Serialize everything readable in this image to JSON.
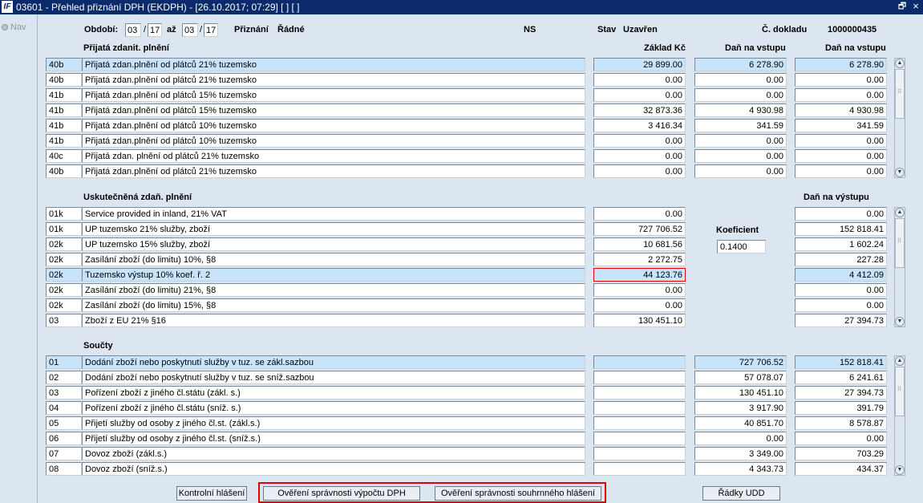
{
  "window": {
    "logo_text": "IF",
    "title": "03601 - Přehled přiznání DPH (EKDPH) - [26.10.2017; 07:29]  [ ]  [ ]",
    "restore_glyph": "🗗",
    "close_glyph": "×"
  },
  "nav": {
    "label": "Nav"
  },
  "header": {
    "obdobi_label": "Období:",
    "from_month": "03",
    "from_year": "17",
    "az_label": "až",
    "to_month": "03",
    "to_year": "17",
    "slash": "/",
    "priznani_label": "Přiznání",
    "priznani_value": "Řádné",
    "ns_label": "NS",
    "stav_label": "Stav",
    "stav_value": "Uzavřen",
    "doklad_label": "Č. dokladu",
    "doklad_value": "1000000435"
  },
  "section_prijata": {
    "title": "Přijatá zdanit. plnění",
    "col_zaklad": "Základ Kč",
    "col_dan_vstup1": "Daň na vstupu",
    "col_dan_vstup2": "Daň na vstupu",
    "rows": [
      {
        "code": "40b",
        "desc": "Přijatá zdan.plnění od plátců 21% tuzemsko",
        "zaklad": "29 899.00",
        "dan1": "6 278.90",
        "dan2": "6 278.90"
      },
      {
        "code": "40b",
        "desc": "Přijatá zdan.plnění od plátců 21% tuzemsko",
        "zaklad": "0.00",
        "dan1": "0.00",
        "dan2": "0.00"
      },
      {
        "code": "41b",
        "desc": "Přijatá zdan.plnění od plátců 15% tuzemsko",
        "zaklad": "0.00",
        "dan1": "0.00",
        "dan2": "0.00"
      },
      {
        "code": "41b",
        "desc": "Přijatá zdan.plnění od plátců 15% tuzemsko",
        "zaklad": "32 873.36",
        "dan1": "4 930.98",
        "dan2": "4 930.98"
      },
      {
        "code": "41b",
        "desc": "Přijatá zdan.plnění od plátců 10% tuzemsko",
        "zaklad": "3 416.34",
        "dan1": "341.59",
        "dan2": "341.59"
      },
      {
        "code": "41b",
        "desc": "Přijatá zdan.plnění od plátců 10% tuzemsko",
        "zaklad": "0.00",
        "dan1": "0.00",
        "dan2": "0.00"
      },
      {
        "code": "40c",
        "desc": "Přijatá zdan. plnění od plátců 21% tuzemsko",
        "zaklad": "0.00",
        "dan1": "0.00",
        "dan2": "0.00"
      },
      {
        "code": "40b",
        "desc": "Přijatá zdan.plnění od plátců 21% tuzemsko",
        "zaklad": "0.00",
        "dan1": "0.00",
        "dan2": "0.00"
      }
    ]
  },
  "section_uskutecnena": {
    "title": "Uskutečněná zdaň. plnění",
    "col_dan_vystup": "Daň na výstupu",
    "koef_label": "Koeficient",
    "koef_value": "0.1400",
    "rows": [
      {
        "code": "01k",
        "desc": "Service provided in inland, 21% VAT",
        "zaklad": "0.00",
        "dan": "0.00"
      },
      {
        "code": "01k",
        "desc": "UP tuzemsko 21% služby, zboží",
        "zaklad": "727 706.52",
        "dan": "152 818.41"
      },
      {
        "code": "02k",
        "desc": "UP tuzemsko 15% služby, zboží",
        "zaklad": "10 681.56",
        "dan": "1 602.24"
      },
      {
        "code": "02k",
        "desc": "Zasílání zboží (do limitu) 10%, §8",
        "zaklad": "2 272.75",
        "dan": "227.28"
      },
      {
        "code": "02k",
        "desc": "Tuzemsko výstup 10% koef. ř. 2",
        "zaklad": "44 123.76",
        "dan": "4 412.09"
      },
      {
        "code": "02k",
        "desc": "Zasílání zboží (do limitu) 21%, §8",
        "zaklad": "0.00",
        "dan": "0.00"
      },
      {
        "code": "02k",
        "desc": "Zasílání zboží (do limitu) 15%, §8",
        "zaklad": "0.00",
        "dan": "0.00"
      },
      {
        "code": "03",
        "desc": "Zboží z EU 21% §16",
        "zaklad": "130 451.10",
        "dan": "27 394.73"
      }
    ]
  },
  "section_soucty": {
    "title": "Součty",
    "rows": [
      {
        "code": "01",
        "desc": "Dodání zboží nebo poskytnutí služby v tuz. se zákl.sazbou",
        "zaklad": "",
        "c2": "727 706.52",
        "c3": "152 818.41"
      },
      {
        "code": "02",
        "desc": "Dodání zboží nebo poskytnutí služby v tuz. se sníž.sazbou",
        "zaklad": "",
        "c2": "57 078.07",
        "c3": "6 241.61"
      },
      {
        "code": "03",
        "desc": "Pořízení zboží z jiného čl.státu (zákl. s.)",
        "zaklad": "",
        "c2": "130 451.10",
        "c3": "27 394.73"
      },
      {
        "code": "04",
        "desc": "Pořízení zboží z jiného čl.státu (sníž. s.)",
        "zaklad": "",
        "c2": "3 917.90",
        "c3": "391.79"
      },
      {
        "code": "05",
        "desc": "Přijetí služby od osoby z jiného čl.st. (zákl.s.)",
        "zaklad": "",
        "c2": "40 851.70",
        "c3": "8 578.87"
      },
      {
        "code": "06",
        "desc": "Přijetí služby od osoby z jiného čl.st. (sníž.s.)",
        "zaklad": "",
        "c2": "0.00",
        "c3": "0.00"
      },
      {
        "code": "07",
        "desc": "Dovoz zboží (zákl.s.)",
        "zaklad": "",
        "c2": "3 349.00",
        "c3": "703.29"
      },
      {
        "code": "08",
        "desc": "Dovoz zboží (sníž.s.)",
        "zaklad": "",
        "c2": "4 343.73",
        "c3": "434.37"
      }
    ]
  },
  "buttons": {
    "kontrolni": "Kontrolní hlášení",
    "overeni_dph": "Ověření správnosti výpočtu DPH",
    "overeni_souhrn": "Ověření správnosti souhrnného hlášení",
    "radky_udd": "Řádky UDD"
  },
  "scrollbar": {
    "up_glyph": "▲",
    "down_glyph": "▼",
    "grip_glyph": "⁝⁝"
  },
  "colors": {
    "titlebar": "#0a2a6b",
    "selected_row": "#c8e4fa",
    "highlight_box": "#e00000",
    "background": "#dce6f0"
  }
}
